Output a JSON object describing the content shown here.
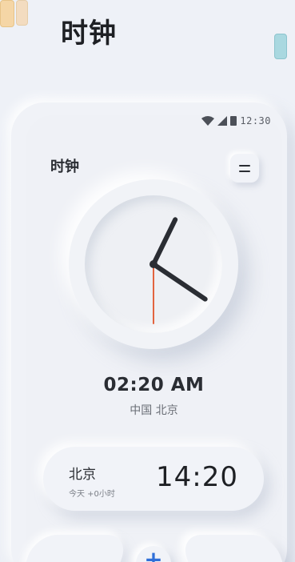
{
  "page": {
    "title": "时钟"
  },
  "status_bar": {
    "time": "12:30",
    "icons": [
      "wifi-icon",
      "signal-icon",
      "battery-icon"
    ]
  },
  "app": {
    "title": "时钟",
    "menu_icon": "menu-icon"
  },
  "clock": {
    "hour": 2,
    "minute": 20,
    "second": 30,
    "digital_time": "02:20 AM",
    "location": "中国 北京",
    "colors": {
      "hands": "#2a2d33",
      "second_hand": "#e2643f",
      "accent": "#2f6fd8"
    }
  },
  "world_clocks": [
    {
      "city": "北京",
      "offset_label": "今天 +0小时",
      "time": "14:20"
    }
  ],
  "bottom_bar": {
    "add_icon": "plus-icon",
    "add_label": "+"
  },
  "decor": {
    "swatch_colors": [
      "#f5d6a6",
      "#f3dcc0",
      "#a9d8e0"
    ]
  }
}
